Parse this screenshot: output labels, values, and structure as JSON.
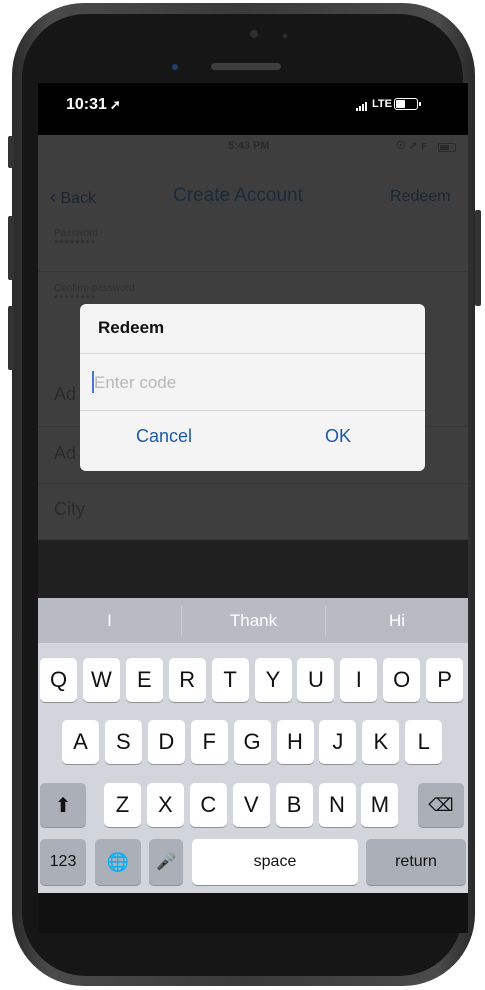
{
  "status": {
    "time": "10:31",
    "network": "LTE"
  },
  "app": {
    "inner_time": "5:43 PM",
    "nav": {
      "back_label": "Back",
      "title": "Create Account",
      "redeem_label": "Redeem"
    },
    "fields": {
      "password_label": "Password",
      "password_value": "********",
      "confirm_label": "Confirm password",
      "confirm_value": "********",
      "address1_partial": "Ad",
      "address2_partial": "Ad",
      "city_label": "City"
    }
  },
  "dialog": {
    "title": "Redeem",
    "input_placeholder": "Enter code",
    "cancel_label": "Cancel",
    "ok_label": "OK"
  },
  "keyboard": {
    "suggestions": [
      "I",
      "Thank",
      "Hi"
    ],
    "row1": [
      "Q",
      "W",
      "E",
      "R",
      "T",
      "Y",
      "U",
      "I",
      "O",
      "P"
    ],
    "row2": [
      "A",
      "S",
      "D",
      "F",
      "G",
      "H",
      "J",
      "K",
      "L"
    ],
    "row3": [
      "Z",
      "X",
      "C",
      "V",
      "B",
      "N",
      "M"
    ],
    "numbers_label": "123",
    "space_label": "space",
    "return_label": "return"
  }
}
